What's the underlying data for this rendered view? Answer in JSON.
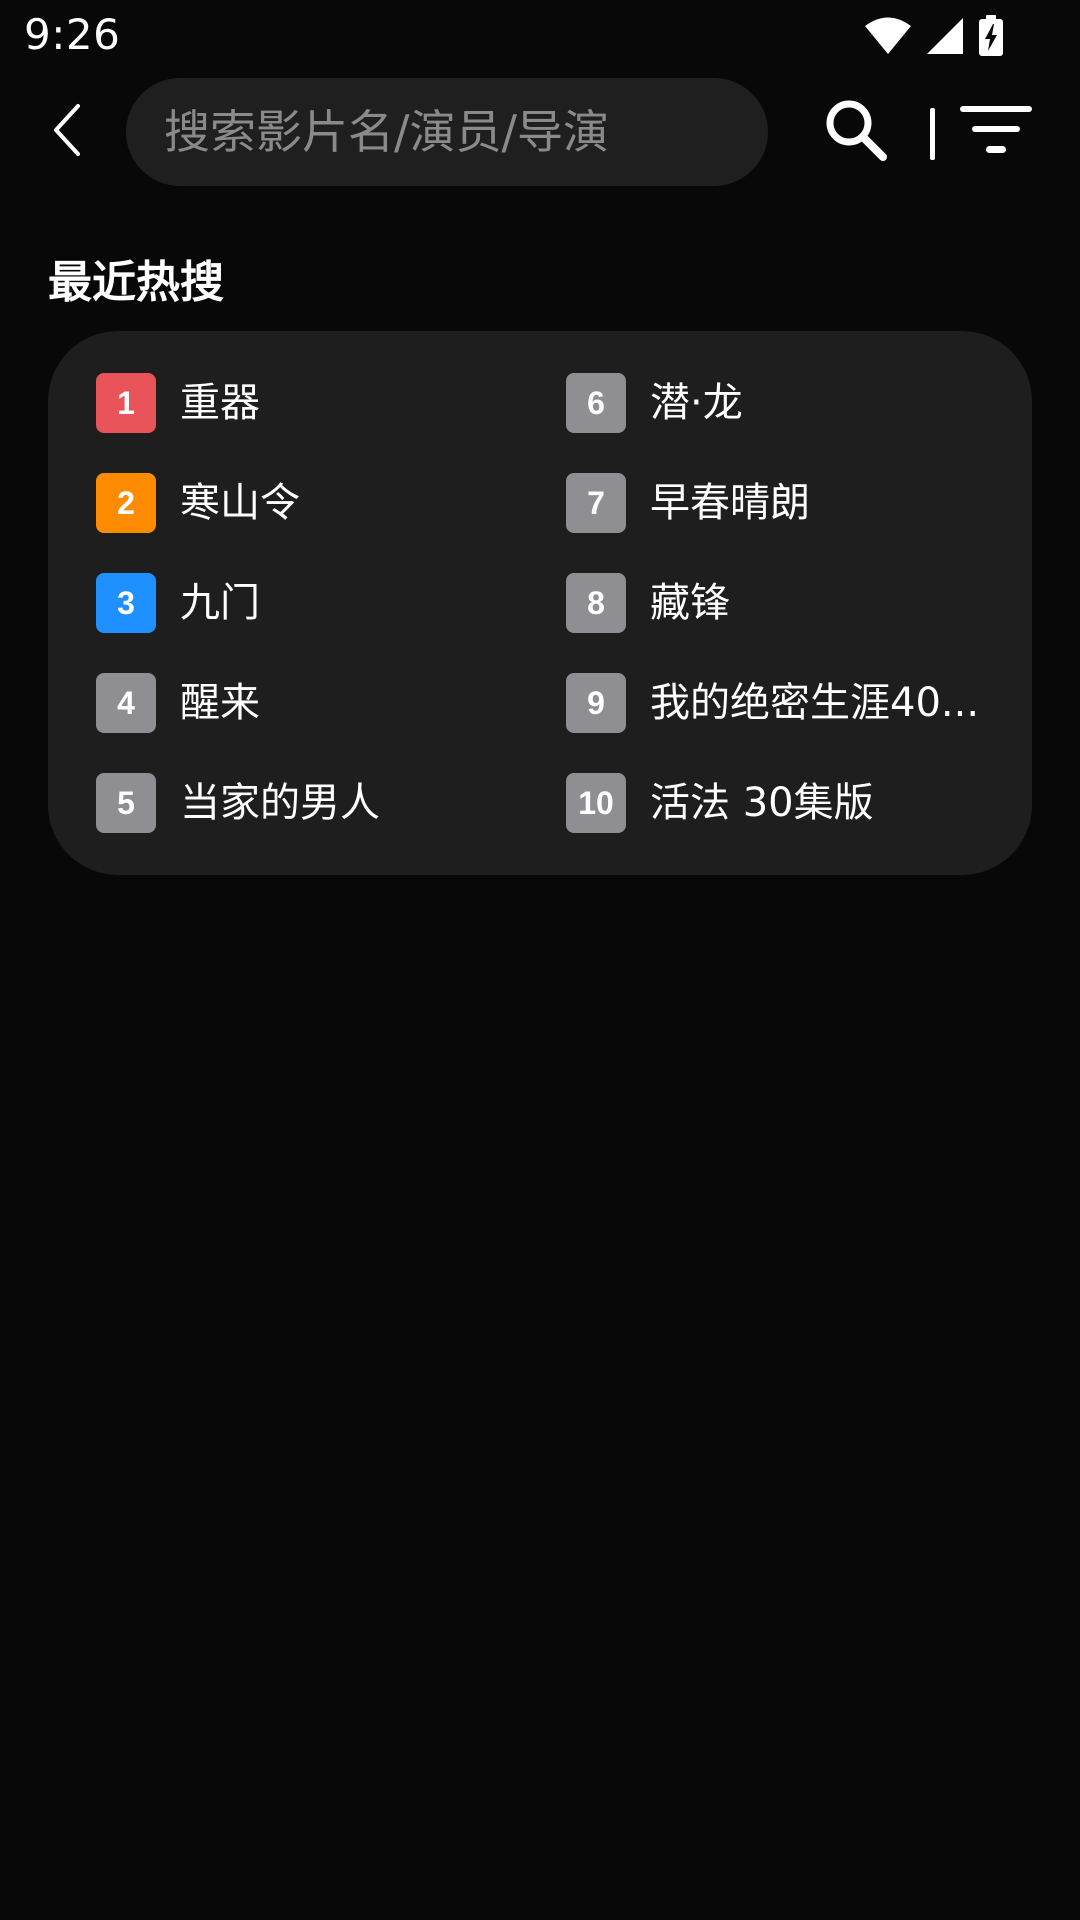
{
  "status_bar": {
    "time": "9:26",
    "icons": [
      "wifi-icon",
      "cell-signal-icon",
      "battery-charging-icon"
    ]
  },
  "top_bar": {
    "back_icon": "chevron-left-icon",
    "search_placeholder": "搜索影片名/演员/导演",
    "search_value": "",
    "search_icon": "search-icon",
    "filter_icon": "filter-icon"
  },
  "hot_search": {
    "title": "最近热搜",
    "items": [
      {
        "rank": "1",
        "title": "重器"
      },
      {
        "rank": "6",
        "title": "潜·龙"
      },
      {
        "rank": "2",
        "title": "寒山令"
      },
      {
        "rank": "7",
        "title": "早春晴朗"
      },
      {
        "rank": "3",
        "title": "九门"
      },
      {
        "rank": "8",
        "title": "藏锋"
      },
      {
        "rank": "4",
        "title": "醒来"
      },
      {
        "rank": "9",
        "title": "我的绝密生涯40..."
      },
      {
        "rank": "5",
        "title": "当家的男人"
      },
      {
        "rank": "10",
        "title": "活法 30集版"
      }
    ]
  },
  "colors": {
    "background": "#080808",
    "card": "#1e1e1e",
    "search_box": "#1f1f1f",
    "rank_1": "#e9545a",
    "rank_2": "#ff8c00",
    "rank_3": "#1e90ff",
    "rank_default": "#8e8e93"
  }
}
